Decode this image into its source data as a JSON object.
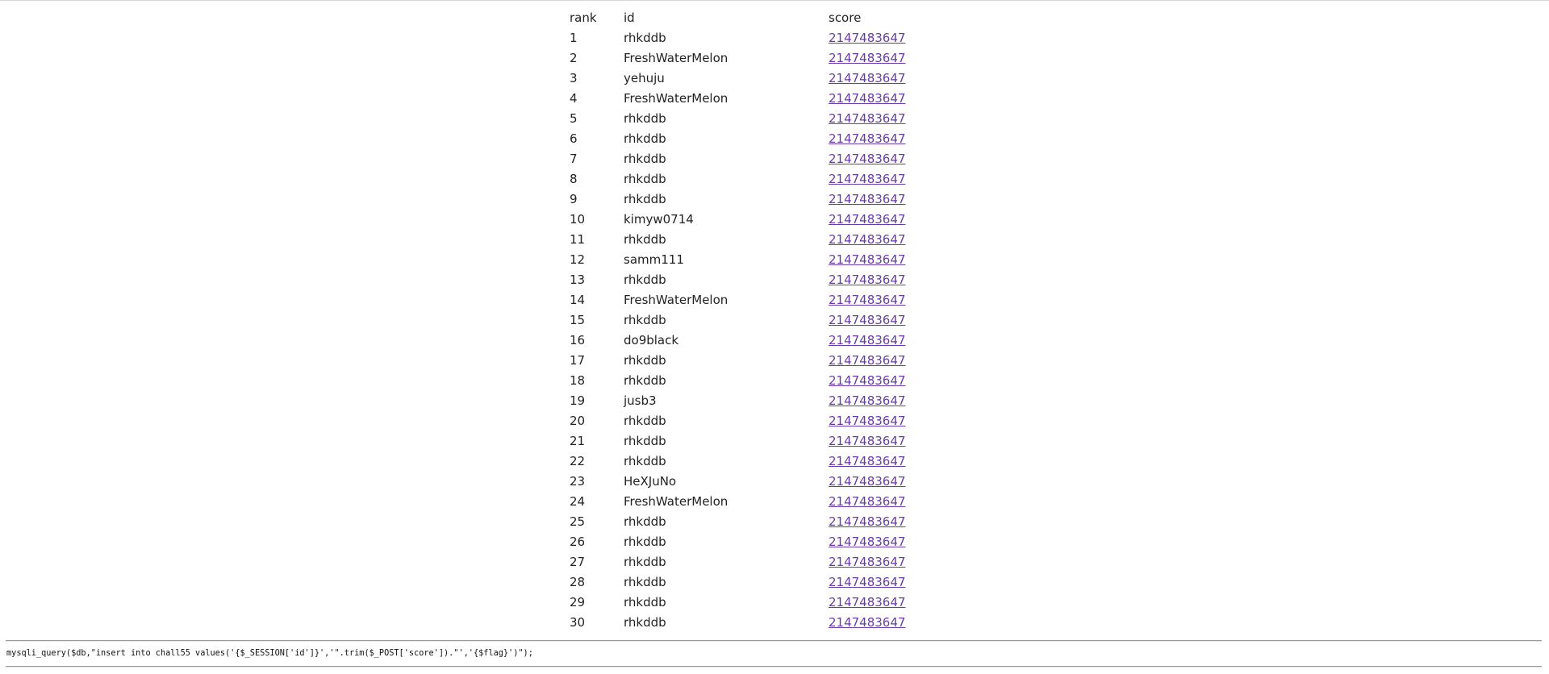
{
  "table": {
    "headers": {
      "rank": "rank",
      "id": "id",
      "score": "score"
    },
    "rows": [
      {
        "rank": "1",
        "id": "rhkddb",
        "score": "2147483647"
      },
      {
        "rank": "2",
        "id": "FreshWaterMelon",
        "score": "2147483647"
      },
      {
        "rank": "3",
        "id": "yehuju",
        "score": "2147483647"
      },
      {
        "rank": "4",
        "id": "FreshWaterMelon",
        "score": "2147483647"
      },
      {
        "rank": "5",
        "id": "rhkddb",
        "score": "2147483647"
      },
      {
        "rank": "6",
        "id": "rhkddb",
        "score": "2147483647"
      },
      {
        "rank": "7",
        "id": "rhkddb",
        "score": "2147483647"
      },
      {
        "rank": "8",
        "id": "rhkddb",
        "score": "2147483647"
      },
      {
        "rank": "9",
        "id": "rhkddb",
        "score": "2147483647"
      },
      {
        "rank": "10",
        "id": "kimyw0714",
        "score": "2147483647"
      },
      {
        "rank": "11",
        "id": "rhkddb",
        "score": "2147483647"
      },
      {
        "rank": "12",
        "id": "samm111",
        "score": "2147483647"
      },
      {
        "rank": "13",
        "id": "rhkddb",
        "score": "2147483647"
      },
      {
        "rank": "14",
        "id": "FreshWaterMelon",
        "score": "2147483647"
      },
      {
        "rank": "15",
        "id": "rhkddb",
        "score": "2147483647"
      },
      {
        "rank": "16",
        "id": "do9black",
        "score": "2147483647"
      },
      {
        "rank": "17",
        "id": "rhkddb",
        "score": "2147483647"
      },
      {
        "rank": "18",
        "id": "rhkddb",
        "score": "2147483647"
      },
      {
        "rank": "19",
        "id": "jusb3",
        "score": "2147483647"
      },
      {
        "rank": "20",
        "id": "rhkddb",
        "score": "2147483647"
      },
      {
        "rank": "21",
        "id": "rhkddb",
        "score": "2147483647"
      },
      {
        "rank": "22",
        "id": "rhkddb",
        "score": "2147483647"
      },
      {
        "rank": "23",
        "id": "HeXJuNo",
        "score": "2147483647"
      },
      {
        "rank": "24",
        "id": "FreshWaterMelon",
        "score": "2147483647"
      },
      {
        "rank": "25",
        "id": "rhkddb",
        "score": "2147483647"
      },
      {
        "rank": "26",
        "id": "rhkddb",
        "score": "2147483647"
      },
      {
        "rank": "27",
        "id": "rhkddb",
        "score": "2147483647"
      },
      {
        "rank": "28",
        "id": "rhkddb",
        "score": "2147483647"
      },
      {
        "rank": "29",
        "id": "rhkddb",
        "score": "2147483647"
      },
      {
        "rank": "30",
        "id": "rhkddb",
        "score": "2147483647"
      }
    ]
  },
  "source_code": "mysqli_query($db,\"insert into chall55 values('{$_SESSION['id']}','\".trim($_POST['score']).\"','{$flag}')\");",
  "colors": {
    "text": "#222222",
    "link_visited": "#6a3aa8",
    "rule": "#9a9a9a"
  }
}
